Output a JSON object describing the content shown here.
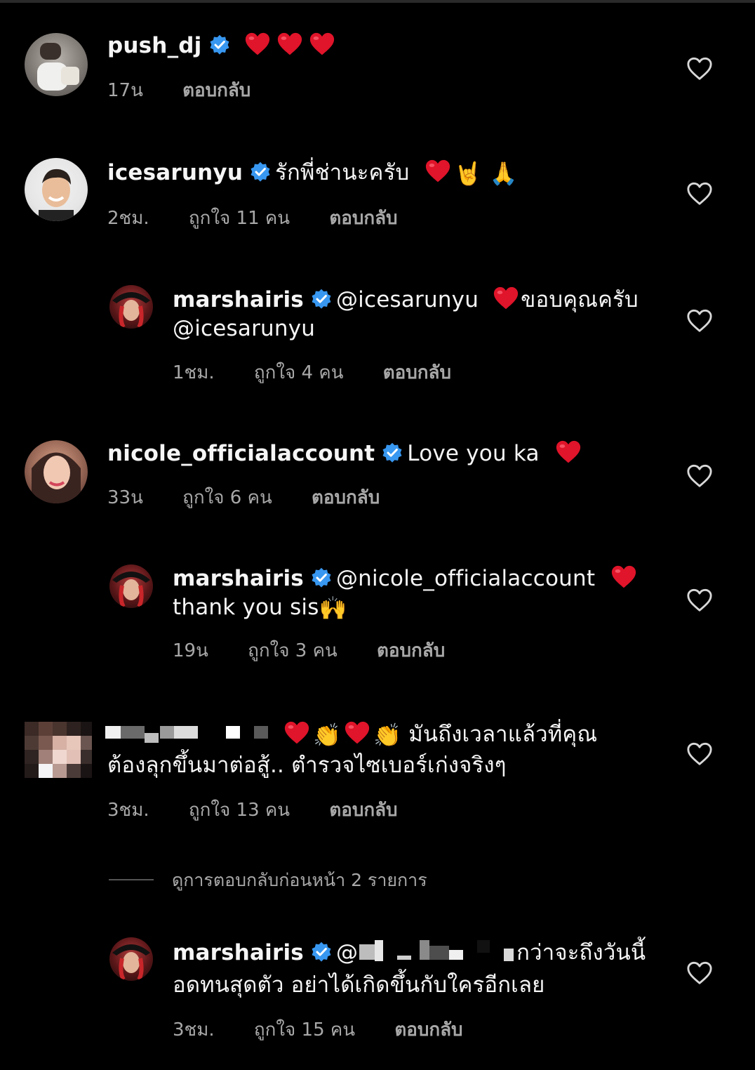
{
  "comments": [
    {
      "username": "push_dj",
      "text": "",
      "time": "17น",
      "likes": "",
      "reply": "ตอบกลับ"
    },
    {
      "username": "icesarunyu",
      "text": "รักพี่ช่านะครับ",
      "time": "2ชม.",
      "likes": "ถูกใจ 11 คน",
      "reply": "ตอบกลับ"
    },
    {
      "username": "marshairis",
      "text": "@icesarunyu",
      "text2": "ขอบคุณครับ",
      "text3": "@icesarunyu",
      "time": "1ชม.",
      "likes": "ถูกใจ 4 คน",
      "reply": "ตอบกลับ"
    },
    {
      "username": "nicole_officialaccount",
      "text": "Love you ka",
      "time": "33น",
      "likes": "ถูกใจ 6 คน",
      "reply": "ตอบกลับ"
    },
    {
      "username": "marshairis",
      "text": "@nicole_officialaccount",
      "text2": "thank you sis",
      "time": "19น",
      "likes": "ถูกใจ 3 คน",
      "reply": "ตอบกลับ"
    },
    {
      "username": "",
      "text": "มันถึงเวลาแล้วที่คุณ",
      "text2": "ต้องลุกขึ้นมาต่อสู้.. ตำรวจไซเบอร์เก่งจริงๆ",
      "time": "3ชม.",
      "likes": "ถูกใจ 13 คน",
      "reply": "ตอบกลับ"
    },
    {
      "username": "marshairis",
      "text": "@",
      "text2": "กว่าจะถึงวันนี้",
      "text3": "อดทนสุดตัว อย่าได้เกิดขึ้นกับใครอีกเลย",
      "time": "3ชม.",
      "likes": "ถูกใจ 15 คน",
      "reply": "ตอบกลับ"
    }
  ],
  "view_previous": "ดูการตอบกลับก่อนหน้า 2 รายการ",
  "icons": {
    "verified": "verified-badge-icon",
    "like": "heart-outline-icon",
    "red_heart": "red-heart-emoji"
  },
  "colors": {
    "background": "#000000",
    "text": "#f5f5f5",
    "muted": "#a8a8a8",
    "verified": "#3897f0",
    "heart": "#e0142a"
  }
}
